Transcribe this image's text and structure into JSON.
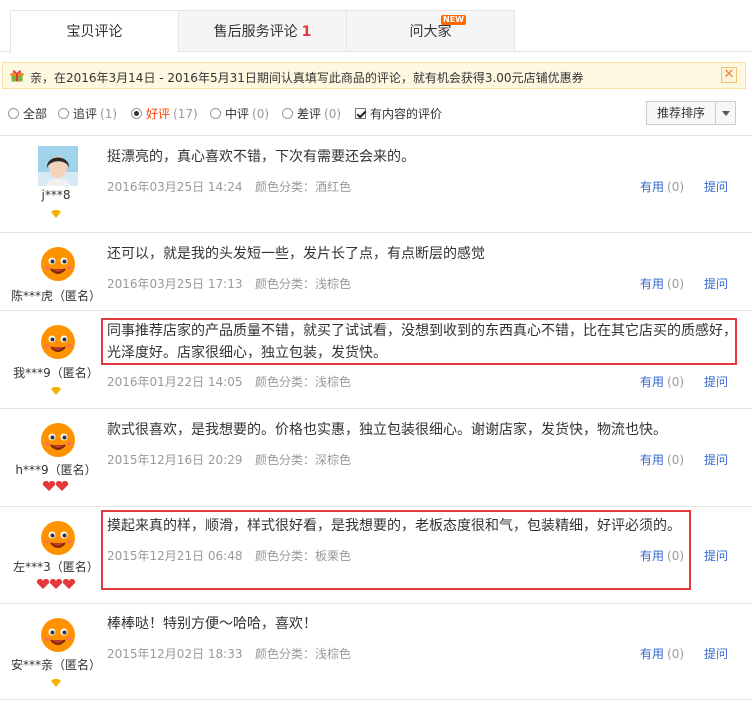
{
  "tabs": [
    {
      "label": "宝贝评论",
      "badge": ""
    },
    {
      "label": "售后服务评论",
      "badge": "1"
    },
    {
      "label": "问大家",
      "badge": "",
      "new": "NEW"
    }
  ],
  "banner": {
    "text": "亲，在2016年3月14日 - 2016年5月31日期间认真填写此商品的评论，就有机会获得3.00元店铺优惠券",
    "close": "✕"
  },
  "filters": [
    {
      "label": "全部",
      "count": ""
    },
    {
      "label": "追评",
      "count": "(1)"
    },
    {
      "label": "好评",
      "count": "(17)"
    },
    {
      "label": "中评",
      "count": "(0)"
    },
    {
      "label": "差评",
      "count": "(0)"
    },
    {
      "label": "有内容的评价",
      "count": ""
    }
  ],
  "sort": {
    "label": "推荐排序"
  },
  "colors": {
    "accent": "#f40",
    "link": "#36c",
    "highlight": "#e4393c"
  },
  "reviews": [
    {
      "user": "j***8",
      "rank": "diamond-1",
      "content": "挺漂亮的，真心喜欢不错，下次有需要还会来的。",
      "date": "2016年03月25日 14:24",
      "meta": "颜色分类：酒红色",
      "useful": "有用",
      "useful_count": "(0)",
      "ask": "提问",
      "avatar": "photo"
    },
    {
      "user": "陈***虎（匿名）",
      "rank": "",
      "content": "还可以，就是我的头发短一些，发片长了点，有点断层的感觉",
      "date": "2016年03月25日 17:13",
      "meta": "颜色分类：浅棕色",
      "useful": "有用",
      "useful_count": "(0)",
      "ask": "提问",
      "avatar": "default"
    },
    {
      "user": "我***9（匿名）",
      "rank": "diamond-1",
      "content": "同事推荐店家的产品质量不错，就买了试试看，没想到收到的东西真心不错，比在其它店买的质感好，光泽度好。店家很细心，独立包装，发货快。",
      "date": "2016年01月22日 14:05",
      "meta": "颜色分类：浅棕色",
      "useful": "有用",
      "useful_count": "(0)",
      "ask": "提问",
      "avatar": "default"
    },
    {
      "user": "h***9（匿名）",
      "rank": "heart-2",
      "content": "款式很喜欢，是我想要的。价格也实惠，独立包装很细心。谢谢店家，发货快，物流也快。",
      "date": "2015年12月16日 20:29",
      "meta": "颜色分类：深棕色",
      "useful": "有用",
      "useful_count": "(0)",
      "ask": "提问",
      "avatar": "default"
    },
    {
      "user": "左***3（匿名）",
      "rank": "heart-3",
      "content": "摸起来真的样，顺滑，样式很好看，是我想要的，老板态度很和气，包装精细，好评必须的。",
      "date": "2015年12月21日 06:48",
      "meta": "颜色分类：板栗色",
      "useful": "有用",
      "useful_count": "(0)",
      "ask": "提问",
      "avatar": "default"
    },
    {
      "user": "安***亲（匿名）",
      "rank": "diamond-1",
      "content": "棒棒哒！特别方便～哈哈，喜欢！",
      "date": "2015年12月02日 18:33",
      "meta": "颜色分类：浅棕色",
      "useful": "有用",
      "useful_count": "(0)",
      "ask": "提问",
      "avatar": "default"
    }
  ]
}
